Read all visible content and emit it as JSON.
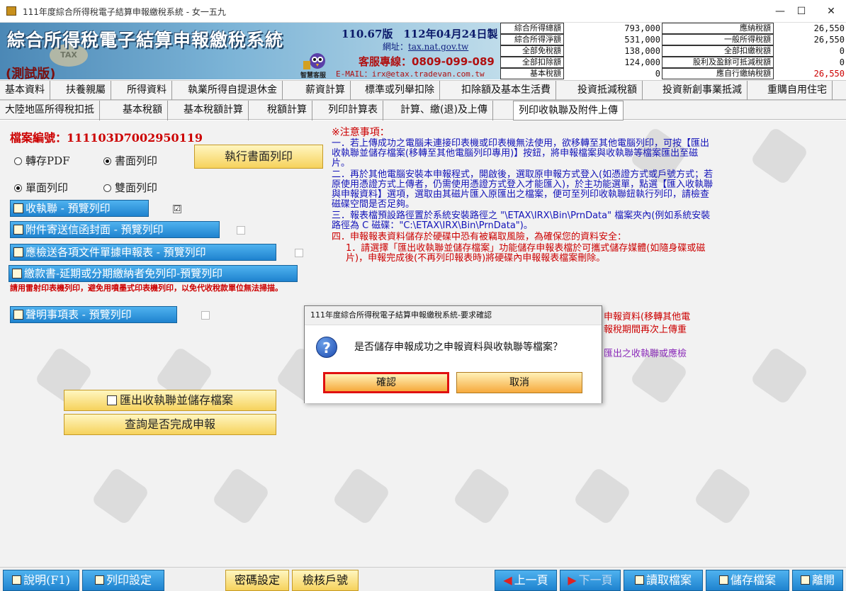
{
  "window": {
    "title": "111年度綜合所得稅電子結算申報繳稅系統 - 女一五九",
    "minimize": "—",
    "maximize": "☐",
    "close": "✕"
  },
  "header": {
    "app_name": "綜合所得稅電子結算申報繳稅系統",
    "test_label": "(測試版)",
    "tax_badge": "TAX",
    "version": "110.67版　112年04月24日製",
    "site_label": "網址：",
    "site_url": "tax.nat.gov.tw",
    "hotline": "客服專線：0809-099-089",
    "email": "E-MAIL：irx@etax.tradevan.com.tw",
    "mascot_caption": "智慧客服"
  },
  "summary_left": [
    {
      "label": "綜合所得總額",
      "value": "793,000"
    },
    {
      "label": "綜合所得淨額",
      "value": "531,000"
    },
    {
      "label": "全部免稅額",
      "value": "138,000"
    },
    {
      "label": "全部扣除額",
      "value": "124,000"
    },
    {
      "label": "基本稅額",
      "value": "0"
    }
  ],
  "summary_right": [
    {
      "label": "應納稅額",
      "value": "26,550"
    },
    {
      "label": "一般所得稅額",
      "value": "26,550"
    },
    {
      "label": "全部扣繳稅額",
      "value": "0"
    },
    {
      "label": "股利及盈餘可抵減稅額",
      "value": "0"
    },
    {
      "label": "應自行繳納稅額",
      "value": "26,550"
    }
  ],
  "menu1": [
    "基本資料",
    "扶養親屬",
    "所得資料",
    "執業所得自提退休金",
    "薪資計算",
    "標準或列舉扣除",
    "扣除額及基本生活費",
    "投資抵減稅額",
    "投資新創事業抵減",
    "重購自用住宅"
  ],
  "menu2": [
    "大陸地區所得稅扣抵",
    "基本稅額",
    "基本稅額計算",
    "稅額計算",
    "列印計算表",
    "計算、繳(退)及上傳",
    "列印收執聯及附件上傳"
  ],
  "panel": {
    "file_no": "檔案編號：111103D7002950119",
    "opt_pdf": "轉存PDF",
    "opt_paper": "書面列印",
    "opt_single": "單面列印",
    "opt_double": "雙面列印",
    "exec_print": "執行書面列印",
    "btn_receipt": "收執聯 - 預覽列印",
    "btn_envelope": "附件寄送信函封面 - 預覽列印",
    "btn_docs": "應檢送各項文件單據申報表 - 預覽列印",
    "btn_payslip": "繳款書-延期或分期繳納者免列印-預覽列印",
    "laser_warning": "請用雷射印表機列印，避免用噴墨式印表機列印，以免代收稅款單位無法掃描。",
    "btn_statement": "聲明事項表 - 預覽列印",
    "receipt_checked": "☑",
    "export_btn": "匯出收執聯並儲存檔案",
    "query_btn": "查詢是否完成申報"
  },
  "notes": {
    "title": "※注意事項：",
    "n1": "一．若上傳成功之電腦未連接印表機或印表機無法使用，欲移轉至其他電腦列印，可按【匯出收執聯並儲存檔案(移轉至其他電腦列印專用)】按鈕，將申報檔案與收執聯等檔案匯出至磁片。",
    "n2": "二．再於其他電腦安裝本申報程式，開啟後，選取原申報方式登入(如憑證方式或戶號方式；若原使用憑證方式上傳者，仍需使用憑證方式登入才能匯入)，於主功能選單，點選【匯入收執聯與申報資料】選項，選取由其磁片匯入原匯出之檔案，便可至列印收執聯鈕執行列印，請檢查磁碟空間是否足夠。",
    "n3": "三．報表檔預設路徑置於系統安裝路徑之 \"\\ETAX\\IRX\\Bin\\PrnData\" 檔案夾內(例如系統安裝路徑為 C 磁碟：\"C:\\ETAX\\IRX\\Bin\\PrnData\")。",
    "n4": "四．申報報表資料儲存於硬碟中恐有被竊取風險，為確保您的資料安全：",
    "n4a": "1．請選擇「匯出收執聯並儲存檔案」功能儲存申報表檔於可攜式儲存媒體(如隨身碟或磁片)，申報完成後(不再列印報表時)將硬碟內申報報表檔案刪除。",
    "n4b": "申報資料(移轉其他電",
    "n4c": "報稅期間再次上傳重",
    "n5": "匯出之收執聯或應檢"
  },
  "dialog": {
    "title": "111年度綜合所得稅電子結算申報繳稅系統-要求確認",
    "message": "是否儲存申報成功之申報資料與收執聯等檔案？",
    "confirm": "確認",
    "cancel": "取消",
    "icon": "?"
  },
  "bottom": {
    "help": "說明(F1)",
    "print_setup": "列印設定",
    "password": "密碼設定",
    "verify": "檢核戶號",
    "prev": "上一頁",
    "next": "下一頁",
    "open": "讀取檔案",
    "save": "儲存檔案",
    "exit": "離開"
  }
}
